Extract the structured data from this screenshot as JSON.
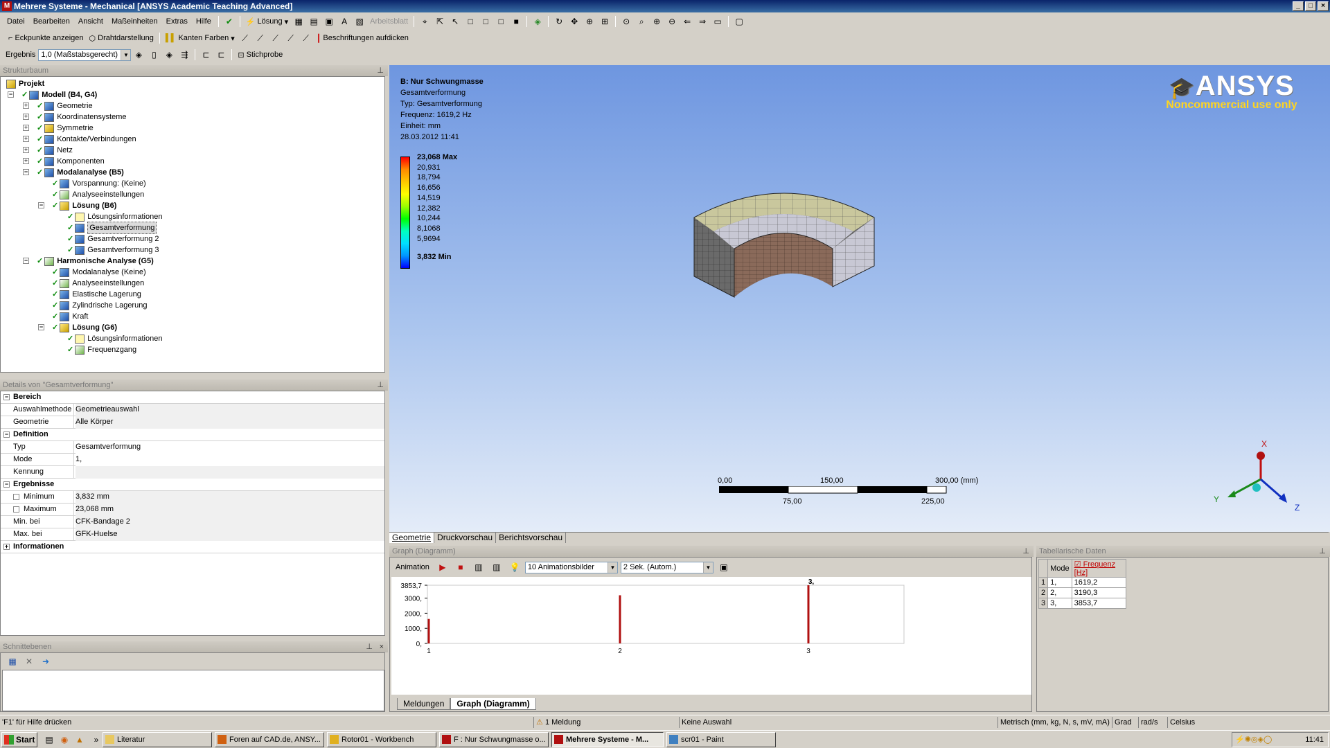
{
  "window": {
    "title": "Mehrere Systeme - Mechanical [ANSYS Academic Teaching Advanced]",
    "controls": [
      "_",
      "□",
      "×"
    ]
  },
  "menu": [
    "Datei",
    "Bearbeiten",
    "Ansicht",
    "Maßeinheiten",
    "Extras",
    "Hilfe"
  ],
  "toolbar": {
    "solve_label": "Lösung",
    "worksheet_label": "Arbeitsblatt",
    "show_vertices": "Eckpunkte anzeigen",
    "wireframe": "Drahtdarstellung",
    "edge_colors": "Kanten Farben",
    "thicken_annotations": "Beschriftungen aufdicken",
    "result_label": "Ergebnis",
    "result_scale": "1,0 (Maßstabsgerecht)",
    "probe_label": "Stichprobe"
  },
  "tree": {
    "header": "Strukturbaum",
    "items": [
      {
        "label": "Projekt",
        "depth": 0,
        "bold": true
      },
      {
        "label": "Modell (B4, G4)",
        "depth": 1,
        "bold": true
      },
      {
        "label": "Geometrie",
        "depth": 2
      },
      {
        "label": "Koordinatensysteme",
        "depth": 2
      },
      {
        "label": "Symmetrie",
        "depth": 2
      },
      {
        "label": "Kontakte/Verbindungen",
        "depth": 2
      },
      {
        "label": "Netz",
        "depth": 2
      },
      {
        "label": "Komponenten",
        "depth": 2
      },
      {
        "label": "Modalanalyse (B5)",
        "depth": 2,
        "bold": true
      },
      {
        "label": "Vorspannung: (Keine)",
        "depth": 3
      },
      {
        "label": "Analyseeinstellungen",
        "depth": 3
      },
      {
        "label": "Lösung (B6)",
        "depth": 3,
        "bold": true
      },
      {
        "label": "Lösungsinformationen",
        "depth": 4
      },
      {
        "label": "Gesamtverformung",
        "depth": 4,
        "selected": true
      },
      {
        "label": "Gesamtverformung 2",
        "depth": 4
      },
      {
        "label": "Gesamtverformung 3",
        "depth": 4
      },
      {
        "label": "Harmonische Analyse (G5)",
        "depth": 2,
        "bold": true
      },
      {
        "label": "Modalanalyse (Keine)",
        "depth": 3
      },
      {
        "label": "Analyseeinstellungen",
        "depth": 3
      },
      {
        "label": "Elastische Lagerung",
        "depth": 3
      },
      {
        "label": "Zylindrische Lagerung",
        "depth": 3
      },
      {
        "label": "Kraft",
        "depth": 3
      },
      {
        "label": "Lösung (G6)",
        "depth": 3,
        "bold": true
      },
      {
        "label": "Lösungsinformationen",
        "depth": 4
      },
      {
        "label": "Frequenzgang",
        "depth": 4
      }
    ]
  },
  "details": {
    "header": "Details von \"Gesamtverformung\"",
    "groups": {
      "bereich": "Bereich",
      "definition": "Definition",
      "ergebnisse": "Ergebnisse",
      "informationen": "Informationen"
    },
    "rows": {
      "auswahlmethode": {
        "k": "Auswahlmethode",
        "v": "Geometrieauswahl"
      },
      "geometrie": {
        "k": "Geometrie",
        "v": "Alle Körper"
      },
      "typ": {
        "k": "Typ",
        "v": "Gesamtverformung"
      },
      "mode": {
        "k": "Mode",
        "v": "1,"
      },
      "kennung": {
        "k": "Kennung",
        "v": ""
      },
      "minimum": {
        "k": "Minimum",
        "v": "3,832 mm"
      },
      "maximum": {
        "k": "Maximum",
        "v": "23,068 mm"
      },
      "min_bei": {
        "k": "Min. bei",
        "v": "CFK-Bandage 2"
      },
      "max_bei": {
        "k": "Max. bei",
        "v": "GFK-Huelse"
      }
    }
  },
  "cut_planes": {
    "header": "Schnittebenen"
  },
  "viewport": {
    "title": "B: Nur Schwungmasse",
    "lines": [
      "Gesamtverformung",
      "Typ: Gesamtverformung",
      "Frequenz: 1619,2 Hz",
      "Einheit: mm",
      "28.03.2012 11:41"
    ],
    "legend": [
      "23,068 Max",
      "20,931",
      "18,794",
      "16,656",
      "14,519",
      "12,382",
      "10,244",
      "8,1068",
      "5,9694",
      "3,832 Min"
    ],
    "legend_colors": [
      "#ff0000",
      "#ff8c00",
      "#ffc800",
      "#ffff00",
      "#9bff00",
      "#00ff00",
      "#00ffc0",
      "#00e0ff",
      "#0096ff",
      "#0000ff"
    ],
    "logo_brand": "ANSYS",
    "logo_note": "Noncommercial use only",
    "scale_top": [
      "0,00",
      "150,00",
      "300,00 (mm)"
    ],
    "scale_bottom": [
      "75,00",
      "225,00"
    ],
    "triad": {
      "x": "X",
      "y": "Y",
      "z": "Z"
    },
    "tabs": [
      "Geometrie",
      "Druckvorschau",
      "Berichtsvorschau"
    ]
  },
  "graph": {
    "header": "Graph (Diagramm)",
    "animation_label": "Animation",
    "frames": "10 Animationsbilder",
    "duration": "2 Sek. (Autom.)",
    "tabs": [
      "Meldungen",
      "Graph (Diagramm)"
    ]
  },
  "chart_data": {
    "type": "bar",
    "categories": [
      "1",
      "2",
      "3"
    ],
    "values": [
      1619.2,
      3190.3,
      3853.7
    ],
    "y_ticks": [
      "0,",
      "1000,",
      "2000,",
      "3000,",
      "3853,7"
    ],
    "ylim": [
      0,
      3853.7
    ],
    "highlight_label": "3,",
    "bar_color": "#b01010",
    "grid": false
  },
  "table": {
    "header": "Tabellarische Daten",
    "columns": [
      "Mode",
      "Frequenz [Hz]"
    ],
    "rows": [
      {
        "n": "1",
        "mode": "1,",
        "freq": "1619,2"
      },
      {
        "n": "2",
        "mode": "2,",
        "freq": "3190,3"
      },
      {
        "n": "3",
        "mode": "3,",
        "freq": "3853,7"
      }
    ]
  },
  "status": {
    "help": "'F1' für Hilfe drücken",
    "messages": "1 Meldung",
    "selection": "Keine Auswahl",
    "units": "Metrisch (mm, kg, N, s, mV, mA)",
    "angle": "Grad",
    "rot": "rad/s",
    "temp": "Celsius"
  },
  "taskbar": {
    "start": "Start",
    "items": [
      "Literatur",
      "Foren auf CAD.de, ANSY...",
      "Rotor01 - Workbench",
      "F : Nur Schwungmasse o...",
      "Mehrere Systeme - M...",
      "scr01 - Paint"
    ],
    "clock": "11:41"
  }
}
